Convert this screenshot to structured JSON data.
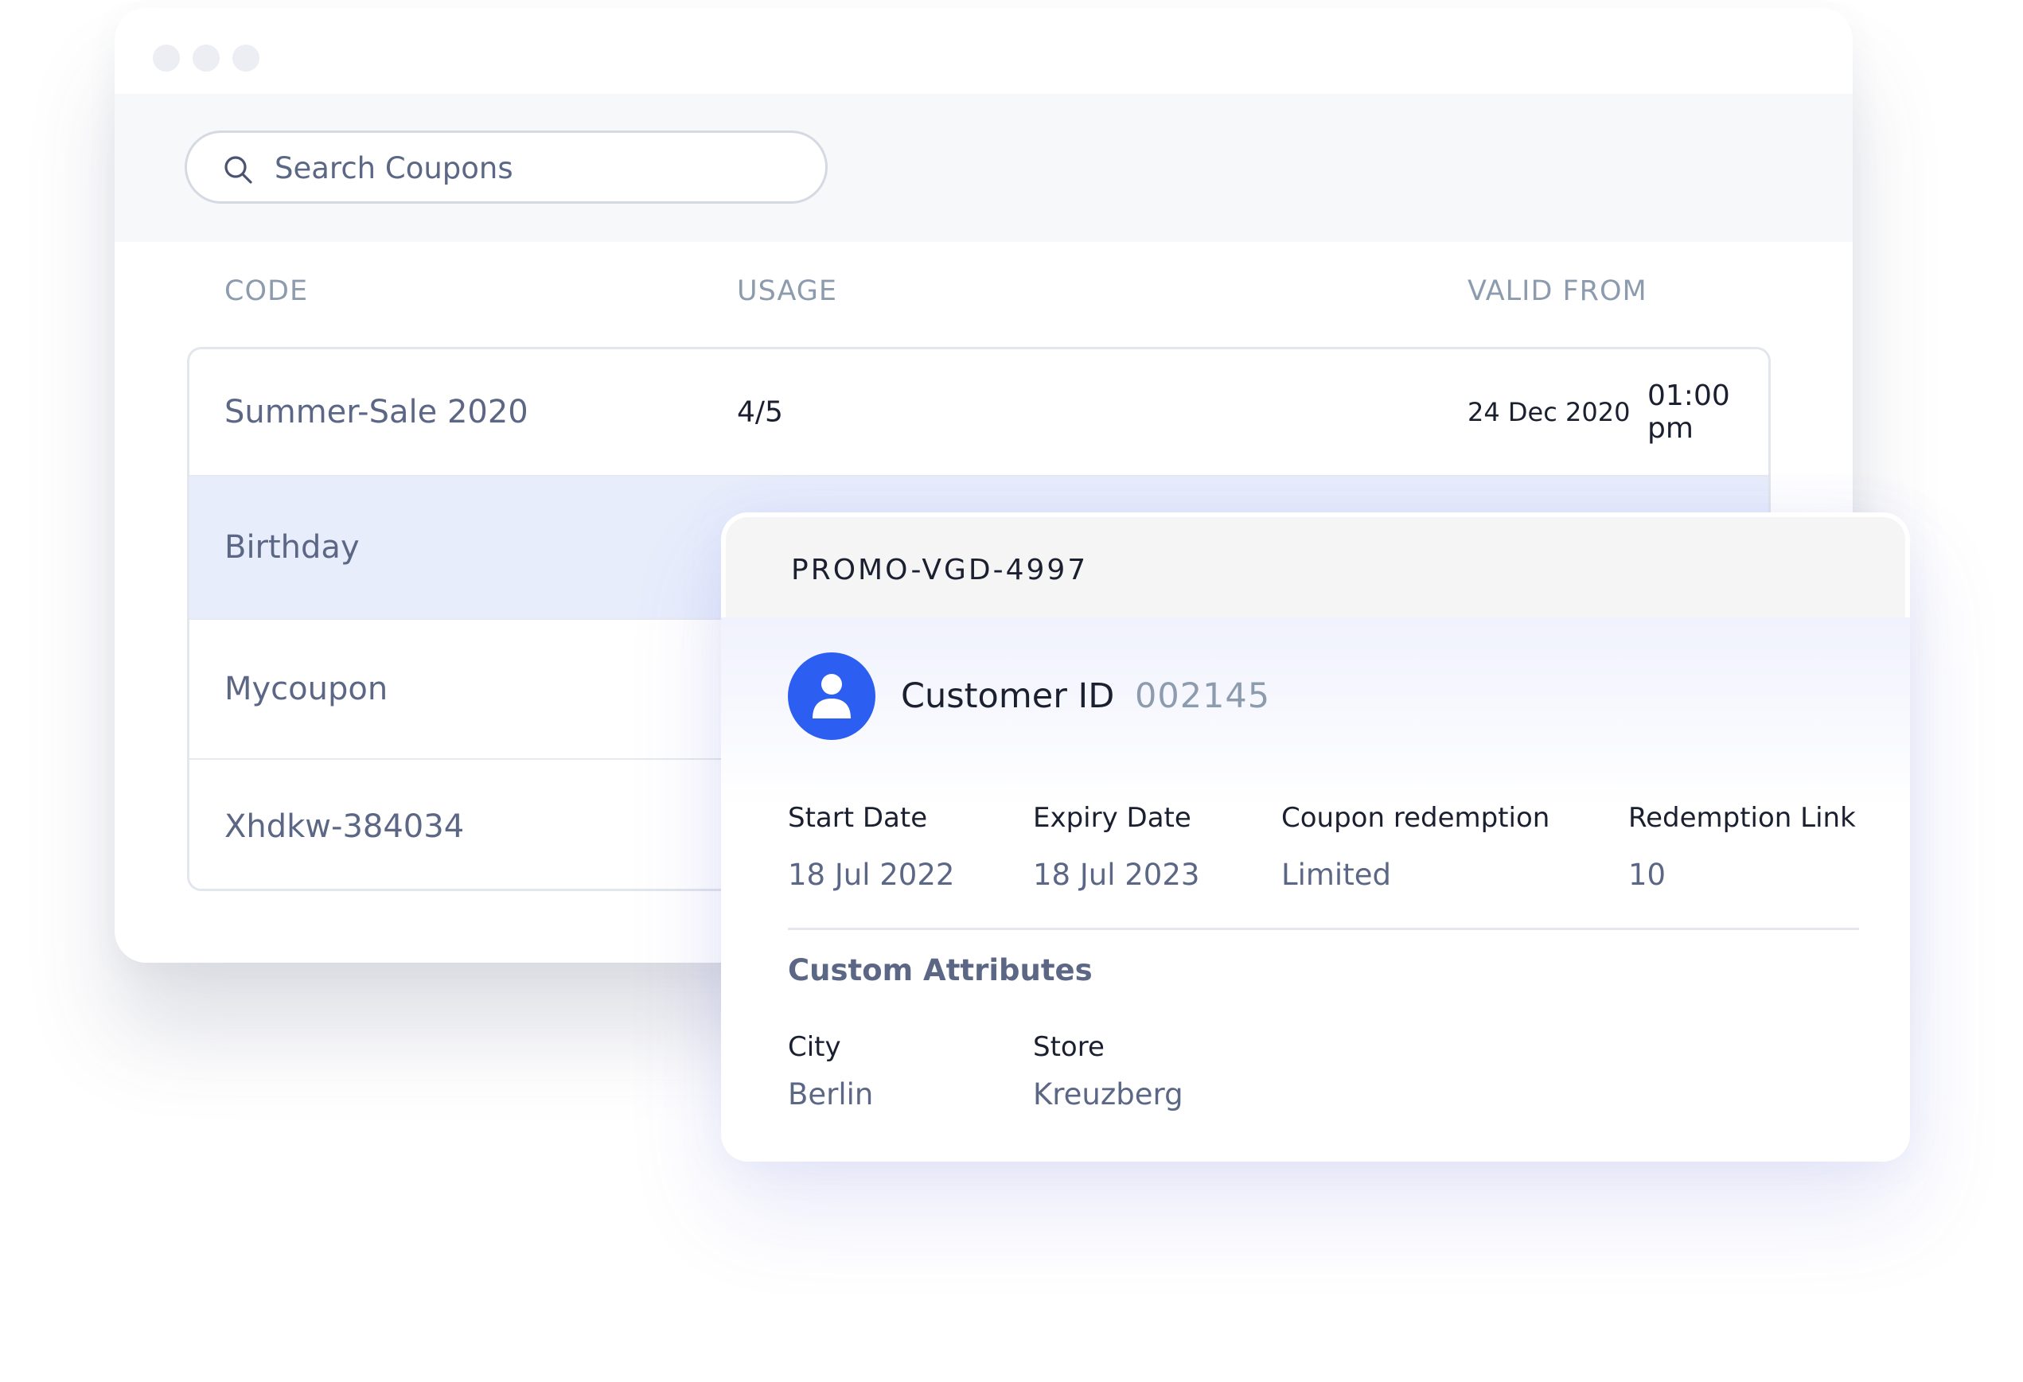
{
  "search": {
    "placeholder": "Search Coupons",
    "value": ""
  },
  "columns": {
    "code": "CODE",
    "usage": "USAGE",
    "valid_from": "VALID FROM"
  },
  "rows": [
    {
      "code": "Summer-Sale 2020",
      "usage": "4/5",
      "date": "24 Dec 2020",
      "time": "01:00 pm"
    },
    {
      "code": "Birthday"
    },
    {
      "code": "Mycoupon"
    },
    {
      "code": "Xhdkw-384034"
    }
  ],
  "card": {
    "promo_code": "PROMO-VGD-4997",
    "customer_label": "Customer ID",
    "customer_id": "002145",
    "fields": [
      {
        "label": "Start Date",
        "value": "18 Jul 2022"
      },
      {
        "label": "Expiry Date",
        "value": "18 Jul 2023"
      },
      {
        "label": "Coupon redemption",
        "value": "Limited"
      },
      {
        "label": "Redemption Link",
        "value": "10"
      }
    ],
    "custom_attributes_title": "Custom Attributes",
    "attributes": [
      {
        "label": "City",
        "value": "Berlin"
      },
      {
        "label": "Store",
        "value": "Kreuzberg"
      }
    ]
  },
  "icons": {
    "search": "search-icon",
    "avatar": "user-icon"
  },
  "colors": {
    "accent": "#2C5EF2",
    "selected_row": "#E8EDFC",
    "muted_text": "#8C9BAD",
    "secondary_text": "#5B6785"
  }
}
